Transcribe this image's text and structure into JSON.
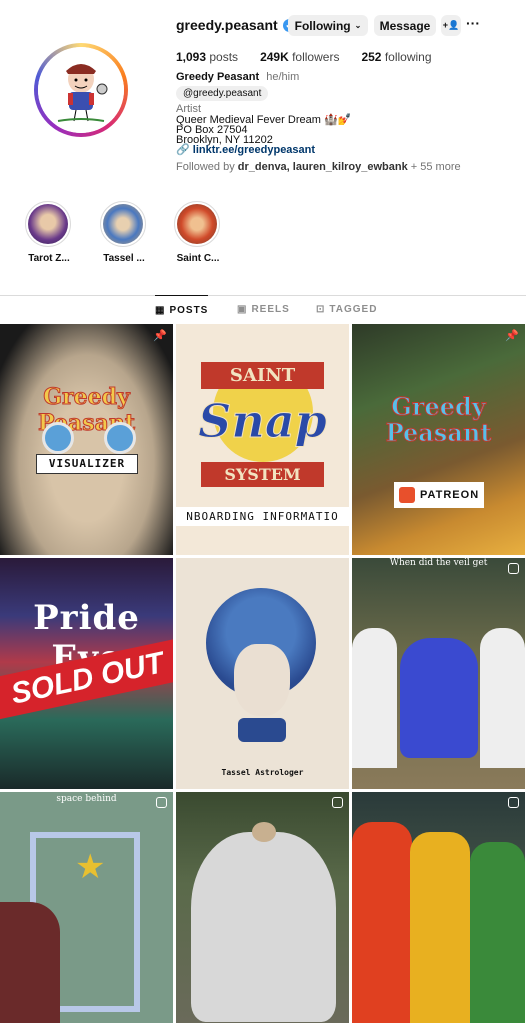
{
  "profile": {
    "username": "greedy.peasant",
    "following_label": "Following",
    "message_label": "Message",
    "more_glyph": "···",
    "stats": {
      "posts_count": "1,093",
      "posts_label": "posts",
      "followers_count": "249K",
      "followers_label": "followers",
      "following_count": "252",
      "following_label": "following"
    },
    "name": "Greedy Peasant",
    "pronouns": "he/him",
    "threads_handle": "greedy.peasant",
    "category": "Artist",
    "bio_line1": "Queer Medieval Fever Dream 🏰💅",
    "bio_line2": "PO Box 27504",
    "bio_line3": "Brooklyn, NY 11202",
    "link": "linktr.ee/greedypeasant",
    "followed_by_prefix": "Followed by ",
    "followed_by_names": "dr_denva, lauren_kilroy_ewbank",
    "followed_by_suffix": " + 55 more"
  },
  "stories": [
    {
      "label": "Tarot Z..."
    },
    {
      "label": "Tassel ..."
    },
    {
      "label": "Saint C..."
    }
  ],
  "tabs": [
    {
      "label": "POSTS"
    },
    {
      "label": "REELS"
    },
    {
      "label": "TAGGED"
    }
  ],
  "posts": {
    "p1_title": "Greedy Peasant",
    "p1_caption": "VISUALIZER",
    "p2_top": "SAINT",
    "p2_mid": "Snap",
    "p2_bottom": "SYSTEM",
    "p2_caption": "NBOARDING INFORMATIO",
    "p3_title": "Greedy Peasant",
    "p3_caption": "PATREON",
    "p4_title": "Pride Eve",
    "p4_banner": "SOLD OUT",
    "p5_caption": "Tassel Astrologer",
    "p6_caption": "When did the veil get",
    "p7_caption": "space behind"
  },
  "colors": {
    "verified": "#3897f0",
    "button_bg": "#efefef",
    "link": "#00376b",
    "sold_out_red": "#d6232b"
  }
}
